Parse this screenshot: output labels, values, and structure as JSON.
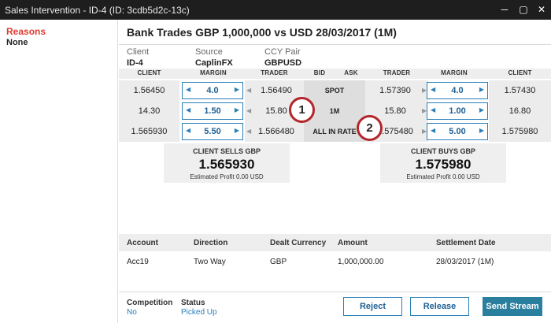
{
  "window": {
    "title": "Sales Intervention - ID-4 (ID: 3cdb5d2c-13c)",
    "controls": [
      "minimize-icon",
      "maximize-icon",
      "close-icon"
    ]
  },
  "sidebar": {
    "title": "Reasons",
    "value": "None"
  },
  "header": {
    "title": "Bank Trades GBP 1,000,000 vs USD 28/03/2017 (1M)"
  },
  "info": [
    {
      "label": "Client",
      "value": "ID-4"
    },
    {
      "label": "Source",
      "value": "CaplinFX"
    },
    {
      "label": "CCY Pair",
      "value": "GBPUSD"
    }
  ],
  "grid": {
    "headers": [
      "CLIENT",
      "MARGIN",
      "TRADER",
      "BID",
      "ASK",
      "TRADER",
      "MARGIN",
      "CLIENT"
    ],
    "rows": [
      {
        "tenor": "SPOT",
        "bid_client": "1.56450",
        "bid_margin": "4.0",
        "bid_trader": "1.56490",
        "ask_trader": "1.57390",
        "ask_margin": "4.0",
        "ask_client": "1.57430"
      },
      {
        "tenor": "1M",
        "bid_client": "14.30",
        "bid_margin": "1.50",
        "bid_trader": "15.80",
        "ask_trader": "15.80",
        "ask_margin": "1.00",
        "ask_client": "16.80"
      },
      {
        "tenor": "ALL IN RATE",
        "bid_client": "1.565930",
        "bid_margin": "5.50",
        "bid_trader": "1.566480",
        "ask_trader": "1.575480",
        "ask_margin": "5.00",
        "ask_client": "1.575980"
      }
    ]
  },
  "quotes": {
    "sell": {
      "title": "CLIENT SELLS GBP",
      "value": "1.565930",
      "profit": "Estimated Profit 0.00 USD"
    },
    "buy": {
      "title": "CLIENT BUYS GBP",
      "value": "1.575980",
      "profit": "Estimated Profit 0.00 USD"
    }
  },
  "deal": {
    "headers": [
      "Account",
      "Direction",
      "Dealt Currency",
      "Amount",
      "Settlement Date"
    ],
    "row": [
      "Acc19",
      "Two Way",
      "GBP",
      "1,000,000.00",
      "28/03/2017 (1M)"
    ]
  },
  "footer": {
    "competition_label": "Competition",
    "competition_value": "No",
    "status_label": "Status",
    "status_value": "Picked Up"
  },
  "buttons": {
    "reject": "Reject",
    "release": "Release",
    "send": "Send Stream"
  },
  "markers": [
    "1",
    "2"
  ],
  "colors": {
    "titlebar": "#1e1e1e",
    "accent": "#2a7fb8",
    "primary_button": "#2a7f9e",
    "reasons": "#e03c31",
    "marker_ring": "#b3262b"
  }
}
